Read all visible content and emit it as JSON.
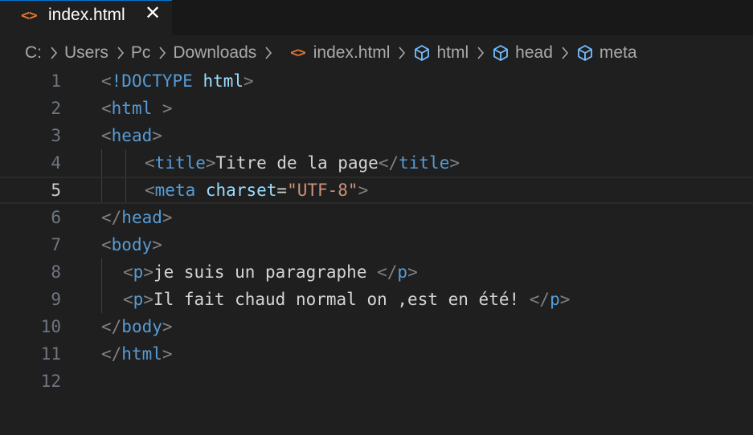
{
  "tab": {
    "icon": "code-icon",
    "label": "index.html",
    "close_glyph": "✕"
  },
  "breadcrumb": {
    "drive": "C:",
    "folders": [
      "Users",
      "Pc",
      "Downloads"
    ],
    "file": "index.html",
    "symbols": [
      "html",
      "head",
      "meta"
    ]
  },
  "editor": {
    "current_line": 5,
    "lines": [
      {
        "num": "1"
      },
      {
        "num": "2"
      },
      {
        "num": "3"
      },
      {
        "num": "4"
      },
      {
        "num": "5"
      },
      {
        "num": "6"
      },
      {
        "num": "7"
      },
      {
        "num": "8"
      },
      {
        "num": "9"
      },
      {
        "num": "10"
      },
      {
        "num": "11"
      },
      {
        "num": "12"
      }
    ],
    "tokens": {
      "l1_open": "<",
      "l1_doctype": "!DOCTYPE",
      "l1_space": " ",
      "l1_html": "html",
      "l1_close": ">",
      "l2_open": "<",
      "l2_name": "html",
      "l2_close": " >",
      "l3_open": "<",
      "l3_name": "head",
      "l3_close": ">",
      "l4_open": "<",
      "l4_name": "title",
      "l4_close": ">",
      "l4_text": "Titre de la page",
      "l4_end_open": "</",
      "l4_end_name": "title",
      "l4_end_close": ">",
      "l5_open": "<",
      "l5_name": "meta",
      "l5_space": " ",
      "l5_attr": "charset",
      "l5_eq": "=",
      "l5_value": "\"UTF-8\"",
      "l5_close": ">",
      "l6_open": "</",
      "l6_name": "head",
      "l6_close": ">",
      "l7_open": "<",
      "l7_name": "body",
      "l7_close": ">",
      "l8_open": "<",
      "l8_name": "p",
      "l8_close": ">",
      "l8_text": "je suis un paragraphe ",
      "l8_end_open": "</",
      "l8_end_name": "p",
      "l8_end_close": ">",
      "l9_open": "<",
      "l9_name": "p",
      "l9_close": ">",
      "l9_text": "Il fait chaud normal on ,est en été! ",
      "l9_end_open": "</",
      "l9_end_name": "p",
      "l9_end_close": ">",
      "l10_open": "</",
      "l10_name": "body",
      "l10_close": ">",
      "l11_open": "</",
      "l11_name": "html",
      "l11_close": ">"
    }
  },
  "colors": {
    "background": "#1f1f1f",
    "tag_bracket": "#808080",
    "tag_name": "#569cd6",
    "attribute": "#9cdcfe",
    "string": "#ce9178",
    "file_icon": "#e37933",
    "symbol_icon": "#75beff"
  }
}
